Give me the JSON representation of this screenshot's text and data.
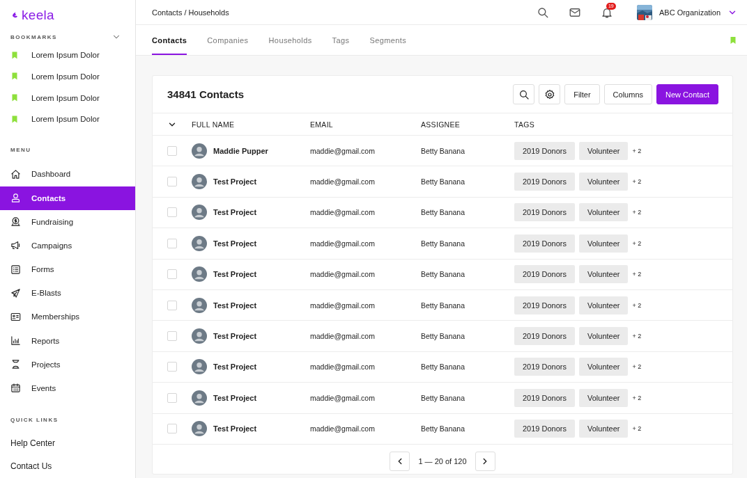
{
  "logo": {
    "text": "keela"
  },
  "sidebar": {
    "sections": [
      {
        "title": "BOOKMARKS",
        "kind": "bookmarks",
        "expanded": true,
        "items": [
          {
            "label": "Lorem Ipsum Dolor",
            "selected": false
          },
          {
            "label": "Lorem Ipsum Dolor",
            "selected": false
          },
          {
            "label": "Lorem Ipsum Dolor",
            "selected": false
          },
          {
            "label": "Lorem Ipsum Dolor",
            "selected": false
          }
        ]
      },
      {
        "title": "MENU",
        "kind": "menu",
        "items": [
          {
            "label": "Dashboard",
            "selected": false
          },
          {
            "label": "Contacts",
            "selected": true
          },
          {
            "label": "Fundraising",
            "selected": false
          },
          {
            "label": "Campaigns",
            "selected": false
          },
          {
            "label": "Forms",
            "selected": false
          },
          {
            "label": "E-Blasts",
            "selected": false
          },
          {
            "label": "Memberships",
            "selected": false
          },
          {
            "label": "Reports",
            "selected": false
          },
          {
            "label": "Projects",
            "selected": false
          },
          {
            "label": "Events",
            "selected": false
          }
        ]
      },
      {
        "title": "QUICK LINKS",
        "kind": "links",
        "items": [
          {
            "label": "Help Center",
            "selected": false
          },
          {
            "label": "Contact Us",
            "selected": false
          }
        ]
      }
    ]
  },
  "top_bar": {
    "breadcrumb": "Contacts / Households",
    "notification_count": "19",
    "organization": "ABC Organization"
  },
  "tabs": [
    {
      "label": "Contacts",
      "selected": true
    },
    {
      "label": "Companies",
      "selected": false
    },
    {
      "label": "Households",
      "selected": false
    },
    {
      "label": "Tags",
      "selected": false
    },
    {
      "label": "Segments",
      "selected": false
    }
  ],
  "table": {
    "title": "34841 Contacts",
    "buttons": [
      "Filter",
      "Columns"
    ],
    "primary_button": "New Contact",
    "columns": [
      "FULL NAME",
      "EMAIL",
      "ASSIGNEE",
      "TAGS"
    ],
    "rows": [
      {
        "name": "Maddie Pupper",
        "email": "maddie@gmail.com",
        "assignee": "Betty Banana",
        "tags": [
          "2019 Donors",
          "Volunteer"
        ],
        "more": "+ 2",
        "checked": false
      },
      {
        "name": "Test Project",
        "email": "maddie@gmail.com",
        "assignee": "Betty Banana",
        "tags": [
          "2019 Donors",
          "Volunteer"
        ],
        "more": "+ 2",
        "checked": false
      },
      {
        "name": "Test Project",
        "email": "maddie@gmail.com",
        "assignee": "Betty Banana",
        "tags": [
          "2019 Donors",
          "Volunteer"
        ],
        "more": "+ 2",
        "checked": false
      },
      {
        "name": "Test Project",
        "email": "maddie@gmail.com",
        "assignee": "Betty Banana",
        "tags": [
          "2019 Donors",
          "Volunteer"
        ],
        "more": "+ 2",
        "checked": false
      },
      {
        "name": "Test Project",
        "email": "maddie@gmail.com",
        "assignee": "Betty Banana",
        "tags": [
          "2019 Donors",
          "Volunteer"
        ],
        "more": "+ 2",
        "checked": false
      },
      {
        "name": "Test Project",
        "email": "maddie@gmail.com",
        "assignee": "Betty Banana",
        "tags": [
          "2019 Donors",
          "Volunteer"
        ],
        "more": "+ 2",
        "checked": false
      },
      {
        "name": "Test Project",
        "email": "maddie@gmail.com",
        "assignee": "Betty Banana",
        "tags": [
          "2019 Donors",
          "Volunteer"
        ],
        "more": "+ 2",
        "checked": false
      },
      {
        "name": "Test Project",
        "email": "maddie@gmail.com",
        "assignee": "Betty Banana",
        "tags": [
          "2019 Donors",
          "Volunteer"
        ],
        "more": "+ 2",
        "checked": false
      },
      {
        "name": "Test Project",
        "email": "maddie@gmail.com",
        "assignee": "Betty Banana",
        "tags": [
          "2019 Donors",
          "Volunteer"
        ],
        "more": "+ 2",
        "checked": false
      },
      {
        "name": "Test Project",
        "email": "maddie@gmail.com",
        "assignee": "Betty Banana",
        "tags": [
          "2019 Donors",
          "Volunteer"
        ],
        "more": "+ 2",
        "checked": false
      }
    ],
    "pagination": "1 — 20 of 120"
  }
}
